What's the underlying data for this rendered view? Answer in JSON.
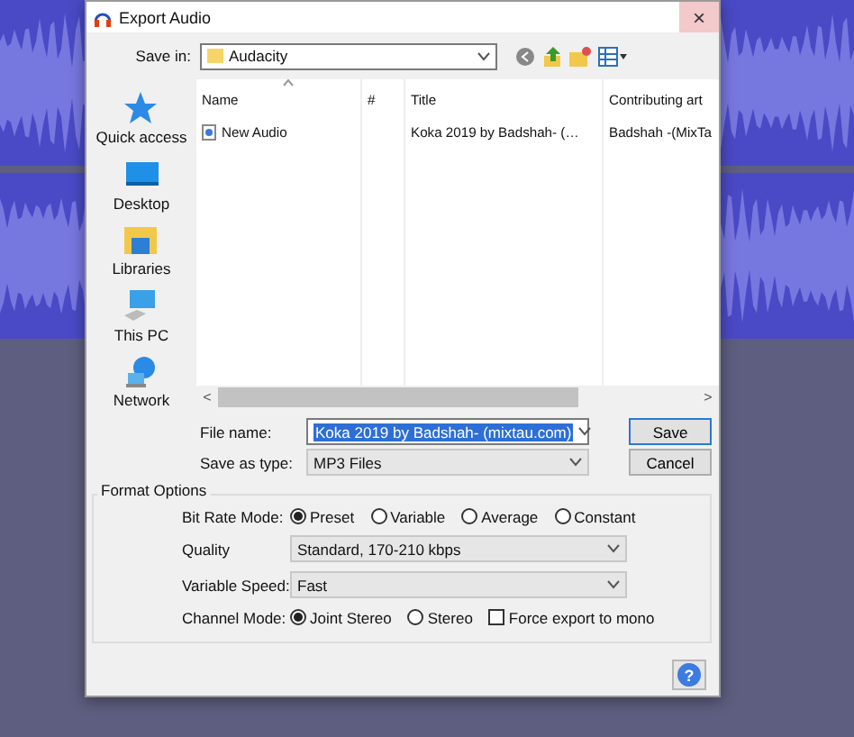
{
  "window": {
    "title": "Export Audio",
    "close": "×"
  },
  "save_in": {
    "label": "Save in:",
    "value": "Audacity"
  },
  "places": [
    {
      "label": "Quick access",
      "kind": "star"
    },
    {
      "label": "Desktop",
      "kind": "desktop"
    },
    {
      "label": "Libraries",
      "kind": "libraries"
    },
    {
      "label": "This PC",
      "kind": "pc"
    },
    {
      "label": "Network",
      "kind": "network"
    }
  ],
  "file_list": {
    "columns": [
      "Name",
      "#",
      "Title",
      "Contributing art"
    ],
    "rows": [
      {
        "name": "New Audio",
        "title": "Koka 2019 by Badshah- (…",
        "artist": "Badshah -(MixTa"
      }
    ],
    "scroll_left": "<",
    "scroll_right": ">"
  },
  "file_name": {
    "label": "File name:",
    "value": "Koka 2019 by Badshah- (mixtau.com)"
  },
  "save_as_type": {
    "label": "Save as type:",
    "value": "MP3 Files"
  },
  "buttons": [
    {
      "label": "Save",
      "default": true
    },
    {
      "label": "Cancel",
      "default": false
    }
  ],
  "format_options": {
    "title": "Format Options",
    "bit_rate_mode": {
      "label": "Bit Rate Mode:",
      "options": [
        {
          "label": "Preset",
          "selected": true
        },
        {
          "label": "Variable",
          "selected": false
        },
        {
          "label": "Average",
          "selected": false
        },
        {
          "label": "Constant",
          "selected": false
        }
      ]
    },
    "quality": {
      "label": "Quality",
      "value": "Standard, 170-210 kbps"
    },
    "variable_speed": {
      "label": "Variable Speed:",
      "value": "Fast"
    },
    "channel_mode": {
      "label": "Channel Mode:",
      "options": [
        {
          "label": "Joint Stereo",
          "selected": true
        },
        {
          "label": "Stereo",
          "selected": false
        }
      ]
    },
    "force_mono": {
      "label": "Force export to mono",
      "checked": false
    }
  },
  "help": "?"
}
